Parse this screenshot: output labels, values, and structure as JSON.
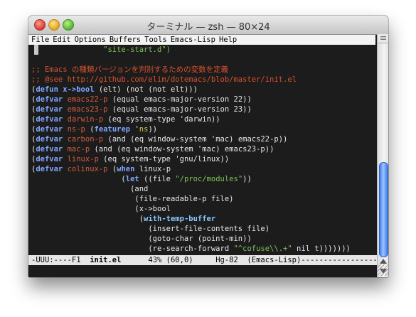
{
  "window": {
    "title": "ターミナル — zsh — 80×24"
  },
  "menubar": {
    "items": [
      "File",
      "Edit",
      "Options",
      "Buffers",
      "Tools",
      "Emacs-Lisp",
      "Help"
    ]
  },
  "code": [
    {
      "segments": [
        {
          "t": "                \"site-start.d\")",
          "c": "str"
        }
      ]
    },
    {
      "segments": [
        {
          "t": "",
          "c": "plain"
        }
      ]
    },
    {
      "segments": [
        {
          "t": ";; Emacs の種類バージョンを判別するための変数を定義",
          "c": "cm"
        }
      ]
    },
    {
      "segments": [
        {
          "t": ";; @see http://github.com/elim/dotemacs/blob/master/init.el",
          "c": "cm"
        }
      ]
    },
    {
      "segments": [
        {
          "t": "(",
          "c": "plain"
        },
        {
          "t": "defun",
          "c": "kw"
        },
        {
          "t": " ",
          "c": "plain"
        },
        {
          "t": "x->bool",
          "c": "kw"
        },
        {
          "t": " (elt) (not (not elt)))",
          "c": "plain"
        }
      ]
    },
    {
      "segments": [
        {
          "t": "(",
          "c": "plain"
        },
        {
          "t": "defvar",
          "c": "kw"
        },
        {
          "t": " ",
          "c": "plain"
        },
        {
          "t": "emacs22-p",
          "c": "var"
        },
        {
          "t": " (equal emacs-major-version 22))",
          "c": "plain"
        }
      ]
    },
    {
      "segments": [
        {
          "t": "(",
          "c": "plain"
        },
        {
          "t": "defvar",
          "c": "kw"
        },
        {
          "t": " ",
          "c": "plain"
        },
        {
          "t": "emacs23-p",
          "c": "var"
        },
        {
          "t": " (equal emacs-major-version 23))",
          "c": "plain"
        }
      ]
    },
    {
      "segments": [
        {
          "t": "(",
          "c": "plain"
        },
        {
          "t": "defvar",
          "c": "kw"
        },
        {
          "t": " ",
          "c": "plain"
        },
        {
          "t": "darwin-p",
          "c": "var"
        },
        {
          "t": " (eq system-type 'darwin))",
          "c": "plain"
        }
      ]
    },
    {
      "segments": [
        {
          "t": "(",
          "c": "plain"
        },
        {
          "t": "defvar",
          "c": "kw"
        },
        {
          "t": " ",
          "c": "plain"
        },
        {
          "t": "ns-p",
          "c": "var"
        },
        {
          "t": " (",
          "c": "plain"
        },
        {
          "t": "featurep",
          "c": "kw"
        },
        {
          "t": " '",
          "c": "plain"
        },
        {
          "t": "ns",
          "c": "spc"
        },
        {
          "t": "))",
          "c": "plain"
        }
      ]
    },
    {
      "segments": [
        {
          "t": "(",
          "c": "plain"
        },
        {
          "t": "defvar",
          "c": "kw"
        },
        {
          "t": " ",
          "c": "plain"
        },
        {
          "t": "carbon-p",
          "c": "var"
        },
        {
          "t": " (and (eq window-system 'mac) emacs22-p))",
          "c": "plain"
        }
      ]
    },
    {
      "segments": [
        {
          "t": "(",
          "c": "plain"
        },
        {
          "t": "defvar",
          "c": "kw"
        },
        {
          "t": " ",
          "c": "plain"
        },
        {
          "t": "mac-p",
          "c": "var"
        },
        {
          "t": " (and (eq window-system 'mac) emacs23-p))",
          "c": "plain"
        }
      ]
    },
    {
      "segments": [
        {
          "t": "(",
          "c": "plain"
        },
        {
          "t": "defvar",
          "c": "kw"
        },
        {
          "t": " ",
          "c": "plain"
        },
        {
          "t": "linux-p",
          "c": "var"
        },
        {
          "t": " (eq system-type 'gnu/linux))",
          "c": "plain"
        }
      ]
    },
    {
      "segments": [
        {
          "t": "(",
          "c": "plain"
        },
        {
          "t": "defvar",
          "c": "kw"
        },
        {
          "t": " ",
          "c": "plain"
        },
        {
          "t": "colinux-p",
          "c": "var"
        },
        {
          "t": " (",
          "c": "plain"
        },
        {
          "t": "when",
          "c": "kw"
        },
        {
          "t": " linux-p",
          "c": "plain"
        }
      ]
    },
    {
      "segments": [
        {
          "t": "                    (",
          "c": "plain"
        },
        {
          "t": "let",
          "c": "kw"
        },
        {
          "t": " ((file ",
          "c": "plain"
        },
        {
          "t": "\"/proc/modules\"",
          "c": "str"
        },
        {
          "t": "))",
          "c": "plain"
        }
      ]
    },
    {
      "segments": [
        {
          "t": "                      (and",
          "c": "plain"
        }
      ]
    },
    {
      "segments": [
        {
          "t": "                       (file-readable-p file)",
          "c": "plain"
        }
      ]
    },
    {
      "segments": [
        {
          "t": "                       (x->bool",
          "c": "plain"
        }
      ]
    },
    {
      "segments": [
        {
          "t": "                        (",
          "c": "plain"
        },
        {
          "t": "with-temp-buffer",
          "c": "st-fn"
        }
      ]
    },
    {
      "segments": [
        {
          "t": "                          (insert-file-contents file)",
          "c": "plain"
        }
      ]
    },
    {
      "segments": [
        {
          "t": "                          (goto-char (point-min))",
          "c": "plain"
        }
      ]
    },
    {
      "segments": [
        {
          "t": "                          (re-search-forward ",
          "c": "plain"
        },
        {
          "t": "\"^cofuse\\\\.+\"",
          "c": "str"
        },
        {
          "t": " nil t)))))))",
          "c": "plain"
        }
      ]
    }
  ],
  "modeline": {
    "prefix": "-UUU:----F1  ",
    "buffer": "init.el",
    "suffix": "      43% (60,0)     Hg-82  (Emacs-Lisp)--------------------"
  }
}
